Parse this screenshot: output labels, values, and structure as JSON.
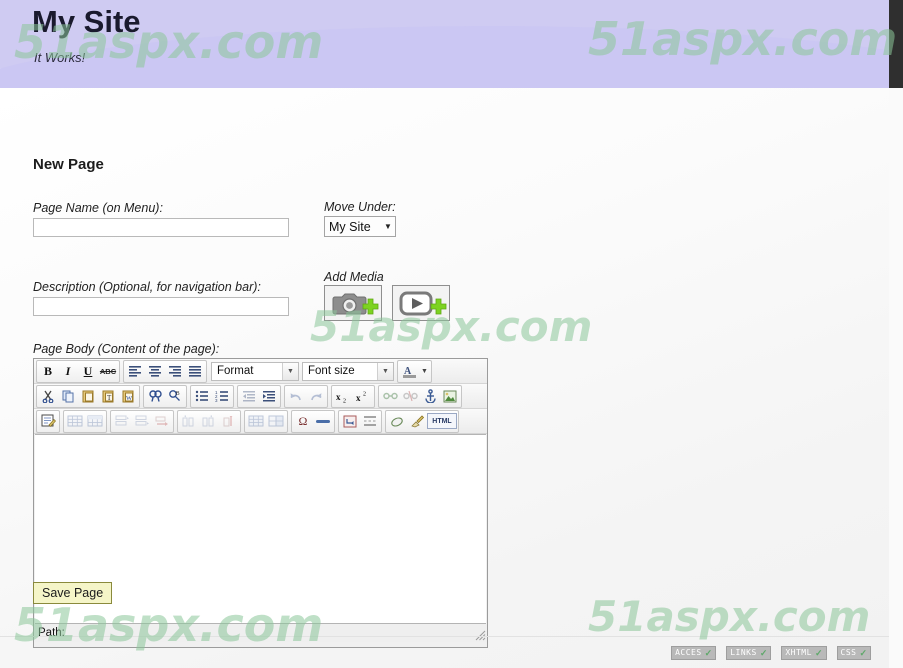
{
  "header": {
    "site_title": "My Site",
    "tagline": "It Works!"
  },
  "watermark": {
    "text": "51aspx.com",
    "color": "#8cc79a"
  },
  "main": {
    "page_heading": "New Page",
    "fields": {
      "page_name_label": "Page Name (on Menu):",
      "page_name_value": "",
      "page_name_placeholder": "",
      "description_label": "Description (Optional, for navigation bar):",
      "description_value": "",
      "description_placeholder": "",
      "page_body_label": "Page Body (Content of the page):"
    },
    "move_under": {
      "label": "Move Under:",
      "selected": "My Site",
      "options": [
        "My Site"
      ]
    },
    "add_media": {
      "label": "Add Media",
      "buttons": [
        {
          "name": "add-photo",
          "icon": "camera-plus-icon"
        },
        {
          "name": "add-video",
          "icon": "video-plus-icon"
        }
      ]
    },
    "save_button": "Save Page"
  },
  "editor": {
    "body_text": "",
    "status_label": "Path:",
    "format_select": {
      "label": "Format",
      "options": [
        "Format"
      ]
    },
    "fontsize_select": {
      "label": "Font size",
      "options": [
        "Font size"
      ]
    },
    "toolbar_rows": [
      {
        "groups": [
          {
            "buttons": [
              {
                "icon": "bold-icon",
                "label": "B"
              },
              {
                "icon": "italic-icon",
                "label": "I"
              },
              {
                "icon": "underline-icon",
                "label": "U"
              },
              {
                "icon": "strikethrough-icon",
                "label": "ABC"
              }
            ]
          },
          {
            "buttons": [
              {
                "icon": "align-left-icon",
                "label": ""
              },
              {
                "icon": "align-center-icon",
                "label": ""
              },
              {
                "icon": "align-right-icon",
                "label": ""
              },
              {
                "icon": "align-justify-icon",
                "label": ""
              }
            ]
          }
        ]
      },
      {
        "groups": [
          {
            "buttons": [
              {
                "icon": "cut-icon",
                "label": ""
              },
              {
                "icon": "copy-icon",
                "label": ""
              },
              {
                "icon": "paste-icon",
                "label": ""
              },
              {
                "icon": "paste-as-text-icon",
                "label": ""
              },
              {
                "icon": "paste-from-word-icon",
                "label": ""
              }
            ]
          },
          {
            "buttons": [
              {
                "icon": "search-icon",
                "label": ""
              },
              {
                "icon": "find-replace-icon",
                "label": ""
              }
            ]
          },
          {
            "buttons": [
              {
                "icon": "bullet-list-icon",
                "label": ""
              },
              {
                "icon": "numbered-list-icon",
                "label": ""
              }
            ]
          },
          {
            "buttons": [
              {
                "icon": "outdent-icon",
                "label": ""
              },
              {
                "icon": "indent-icon",
                "label": ""
              }
            ]
          },
          {
            "buttons": [
              {
                "icon": "undo-icon",
                "label": ""
              },
              {
                "icon": "redo-icon",
                "label": ""
              }
            ]
          },
          {
            "buttons": [
              {
                "icon": "subscript-icon",
                "label": ""
              },
              {
                "icon": "superscript-icon",
                "label": ""
              }
            ]
          },
          {
            "buttons": [
              {
                "icon": "link-icon",
                "label": ""
              },
              {
                "icon": "unlink-icon",
                "label": ""
              },
              {
                "icon": "anchor-icon",
                "label": ""
              },
              {
                "icon": "insert-image-icon",
                "label": ""
              }
            ]
          }
        ]
      },
      {
        "groups": [
          {
            "buttons": [
              {
                "icon": "edit-source-icon",
                "label": ""
              }
            ]
          },
          {
            "buttons": [
              {
                "icon": "insert-table-icon",
                "label": ""
              },
              {
                "icon": "table-properties-icon",
                "label": ""
              }
            ]
          },
          {
            "buttons": [
              {
                "icon": "row-before-icon",
                "label": ""
              },
              {
                "icon": "row-after-icon",
                "label": ""
              },
              {
                "icon": "delete-row-icon",
                "label": ""
              }
            ]
          },
          {
            "buttons": [
              {
                "icon": "col-before-icon",
                "label": ""
              },
              {
                "icon": "col-after-icon",
                "label": ""
              },
              {
                "icon": "delete-col-icon",
                "label": ""
              }
            ]
          },
          {
            "buttons": [
              {
                "icon": "split-cells-icon",
                "label": ""
              },
              {
                "icon": "merge-cells-icon",
                "label": ""
              }
            ]
          },
          {
            "buttons": [
              {
                "icon": "special-char-icon",
                "label": "Ω"
              },
              {
                "icon": "horizontal-rule-icon",
                "label": ""
              }
            ]
          },
          {
            "buttons": [
              {
                "icon": "nonbreaking-icon",
                "label": ""
              },
              {
                "icon": "page-break-icon",
                "label": ""
              }
            ]
          },
          {
            "buttons": [
              {
                "icon": "remove-format-icon",
                "label": ""
              },
              {
                "icon": "cleanup-icon",
                "label": ""
              },
              {
                "icon": "html-source-icon",
                "label": "HTML"
              }
            ]
          }
        ]
      }
    ]
  },
  "footer": {
    "badges": [
      {
        "text": "ACCES",
        "check": "✓"
      },
      {
        "text": "LINKS",
        "check": "✓"
      },
      {
        "text": "XHTML",
        "check": "✓"
      },
      {
        "text": "CSS",
        "check": "✓"
      }
    ]
  }
}
